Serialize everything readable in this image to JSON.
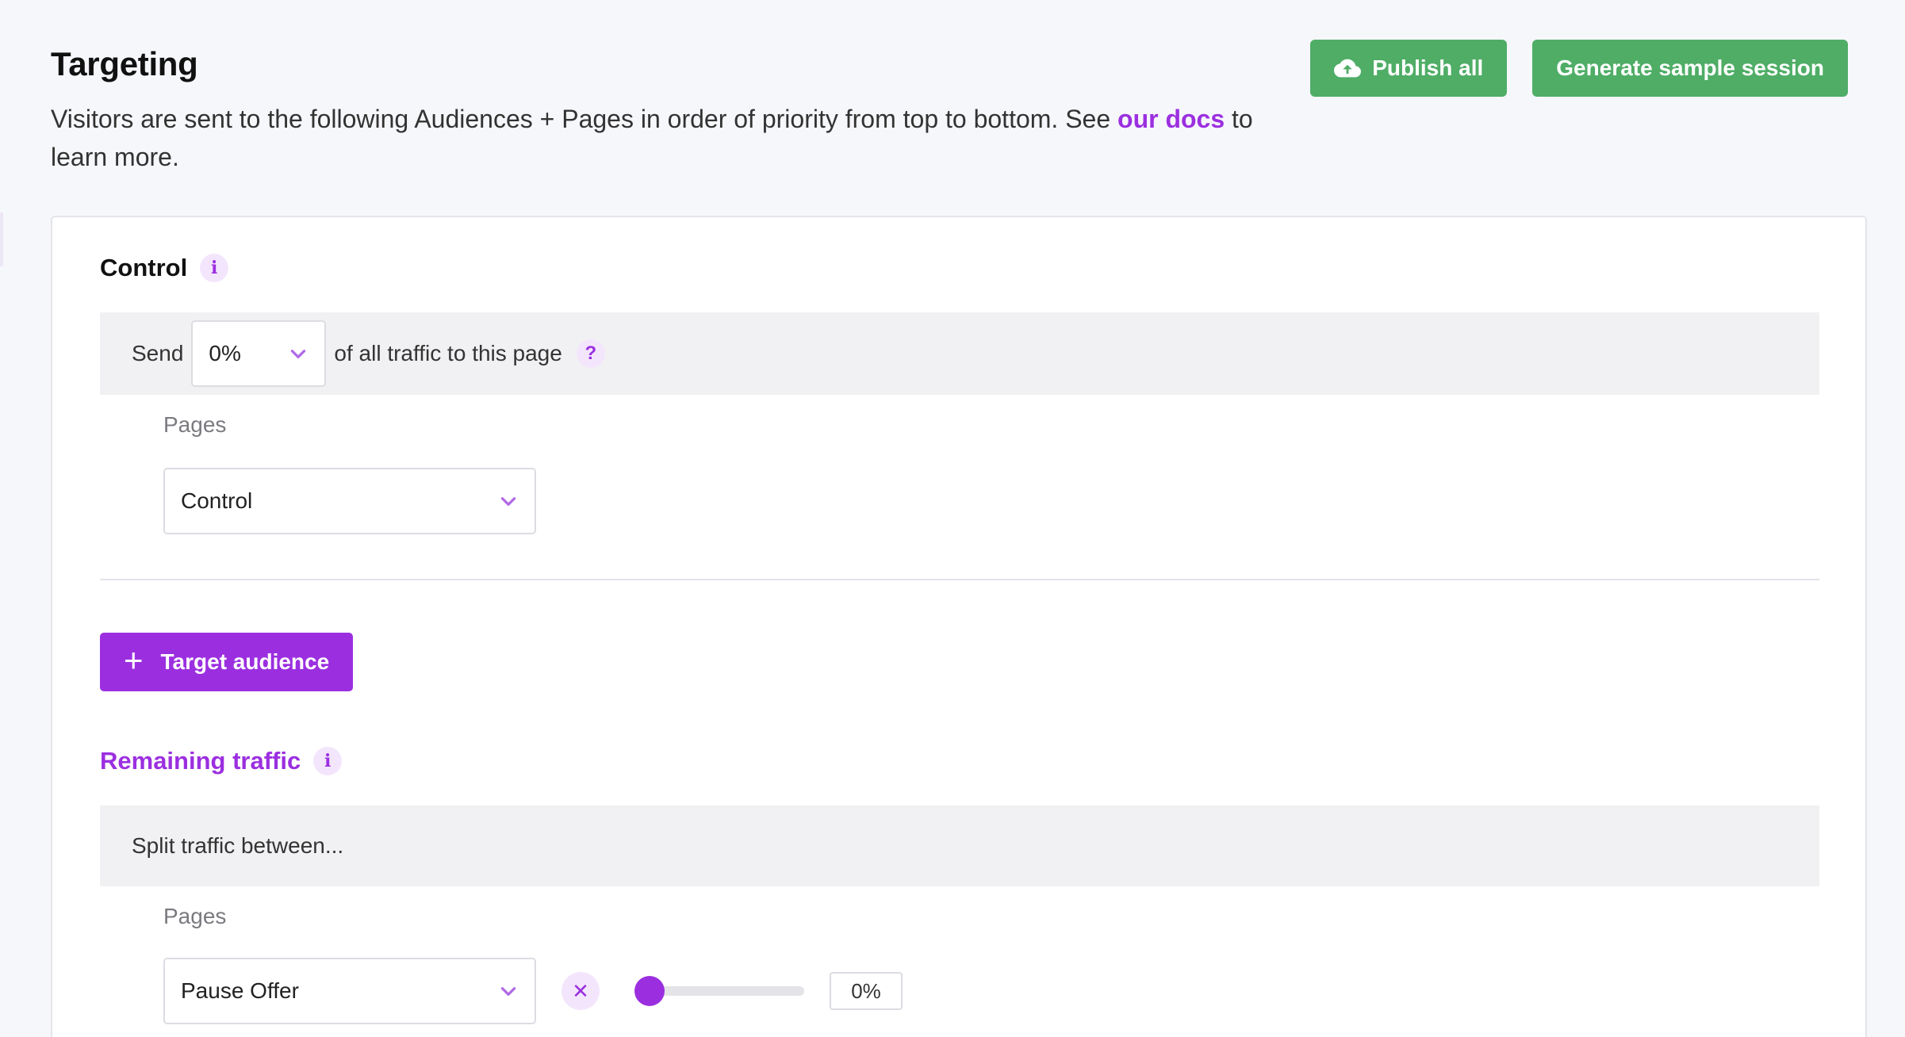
{
  "header": {
    "title": "Targeting",
    "description_before": "Visitors are sent to the following Audiences + Pages in order of priority from top to bottom. See ",
    "docs_link": "our docs",
    "description_after": " to learn more."
  },
  "actions": {
    "publish_label": "Publish all",
    "generate_label": "Generate sample session"
  },
  "control": {
    "title": "Control",
    "info_icon": "i",
    "send_prefix": "Send",
    "send_value": "0%",
    "send_suffix": "of all traffic to this page",
    "help_icon": "?",
    "pages_label": "Pages",
    "page_value": "Control"
  },
  "target_audience": {
    "label": "Target audience"
  },
  "remaining": {
    "title": "Remaining traffic",
    "info_icon": "i",
    "split_text": "Split traffic between...",
    "pages_label": "Pages",
    "pages": [
      {
        "name": "Pause Offer",
        "percent": "0%",
        "slider_fraction": 0
      }
    ]
  },
  "colors": {
    "brand_purple": "#9b2fe0",
    "publish_green": "#4fad66"
  },
  "icons": {
    "publish": "cloud-upload-icon",
    "dropdown": "chevron-down-icon",
    "remove": "close-icon",
    "add": "plus-icon"
  }
}
